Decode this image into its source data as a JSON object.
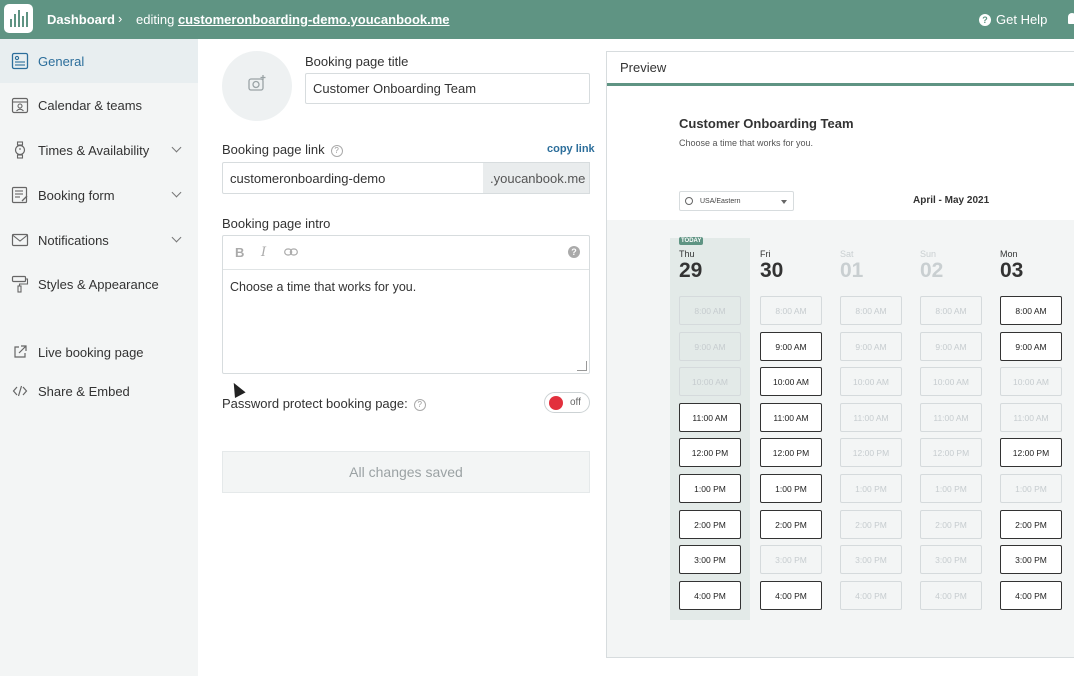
{
  "topbar": {
    "dashboard": "Dashboard",
    "editing_prefix": "editing",
    "editing_link": "customeronboarding-demo.youcanbook.me",
    "help": "Get Help"
  },
  "sidebar": {
    "items": [
      {
        "label": "General",
        "icon": "document-icon",
        "active": true
      },
      {
        "label": "Calendar & teams",
        "icon": "calendar-team-icon"
      },
      {
        "label": "Times & Availability",
        "icon": "watch-icon",
        "chevron": true
      },
      {
        "label": "Booking form",
        "icon": "form-icon",
        "chevron": true
      },
      {
        "label": "Notifications",
        "icon": "envelope-icon",
        "chevron": true
      },
      {
        "label": "Styles & Appearance",
        "icon": "paint-roller-icon"
      },
      {
        "label": "Live booking page",
        "icon": "external-link-icon"
      },
      {
        "label": "Share & Embed",
        "icon": "code-icon"
      }
    ]
  },
  "form": {
    "title_label": "Booking page title",
    "title_value": "Customer Onboarding Team",
    "link_label": "Booking page link",
    "copy_link": "copy link",
    "link_value": "customeronboarding-demo",
    "link_suffix": ".youcanbook.me",
    "intro_label": "Booking page intro",
    "intro_text": "Choose a time that works for you.",
    "password_label": "Password protect booking page:",
    "toggle_text": "off",
    "saved": "All changes saved"
  },
  "preview": {
    "header": "Preview",
    "title": "Customer Onboarding Team",
    "subtitle": "Choose a time that works for you.",
    "timezone": "USA/Eastern",
    "month": "April - May 2021",
    "today_badge": "TODAY",
    "days": [
      {
        "name": "Thu",
        "num": "29",
        "muted": false,
        "today": true
      },
      {
        "name": "Fri",
        "num": "30",
        "muted": false
      },
      {
        "name": "Sat",
        "num": "01",
        "muted": true
      },
      {
        "name": "Sun",
        "num": "02",
        "muted": true
      },
      {
        "name": "Mon",
        "num": "03",
        "muted": false
      }
    ],
    "times": [
      "8:00 AM",
      "9:00 AM",
      "10:00 AM",
      "11:00 AM",
      "12:00 PM",
      "1:00 PM",
      "2:00 PM",
      "3:00 PM",
      "4:00 PM"
    ],
    "availability": [
      [
        false,
        false,
        false,
        true,
        true,
        true,
        true,
        true,
        true
      ],
      [
        false,
        true,
        true,
        true,
        true,
        true,
        true,
        false,
        true
      ],
      [
        false,
        false,
        false,
        false,
        false,
        false,
        false,
        false,
        false
      ],
      [
        false,
        false,
        false,
        false,
        false,
        false,
        false,
        false,
        false
      ],
      [
        true,
        true,
        false,
        false,
        true,
        false,
        true,
        true,
        true
      ]
    ]
  }
}
